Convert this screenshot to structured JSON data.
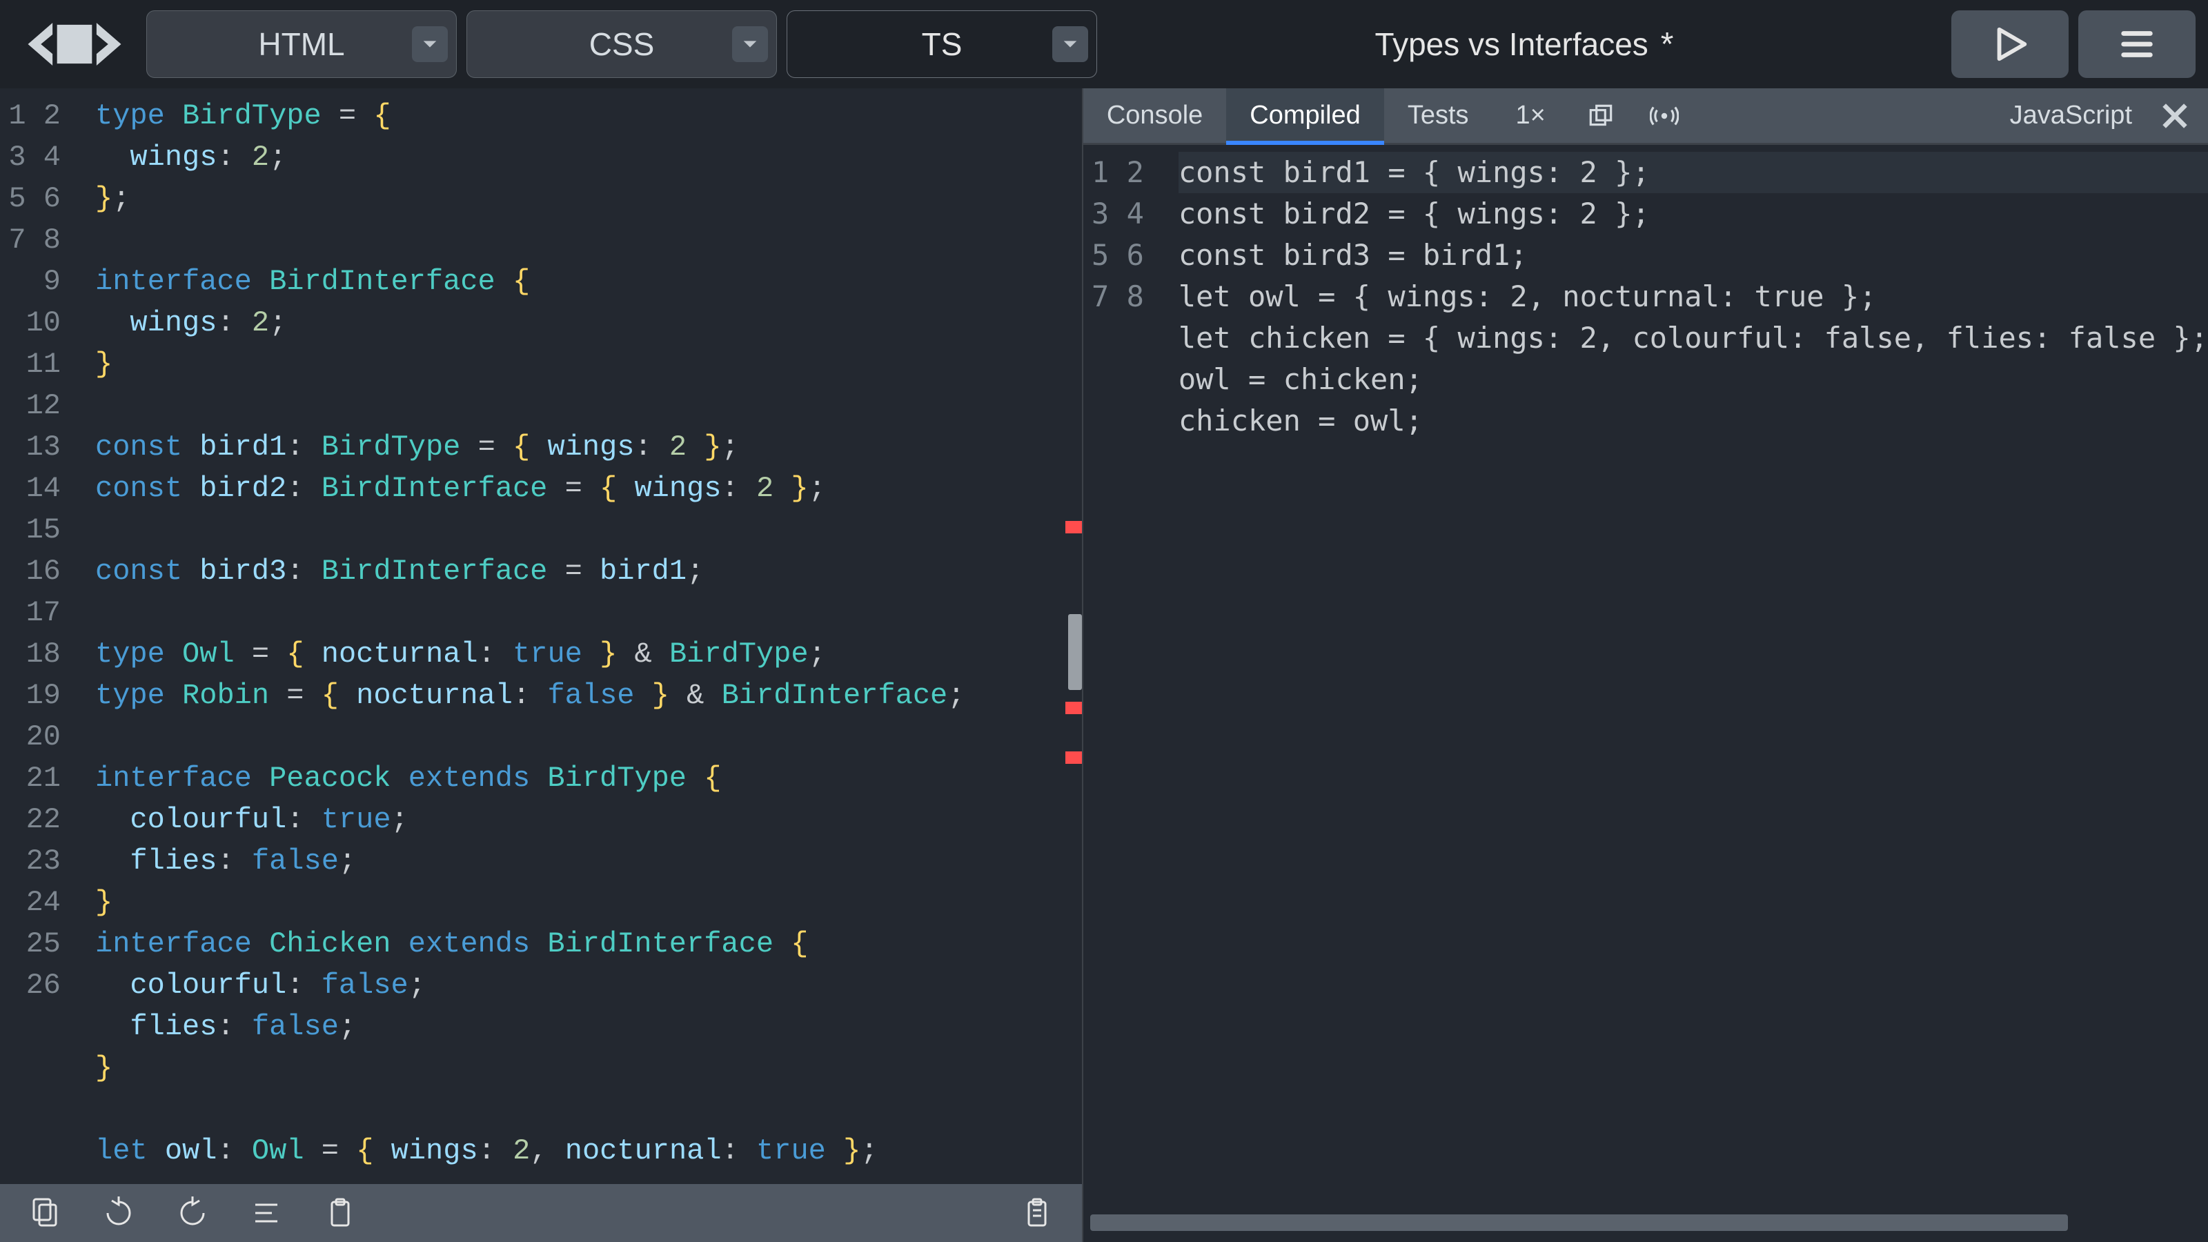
{
  "tabs": {
    "html": "HTML",
    "css": "CSS",
    "ts": "TS",
    "active": "TS"
  },
  "title": "Types vs Interfaces",
  "dirty_indicator": "*",
  "right_tabs": {
    "console": "Console",
    "compiled": "Compiled",
    "tests": "Tests",
    "zoom": "1×",
    "language": "JavaScript",
    "active": "Compiled"
  },
  "left_editor": {
    "line_numbers": [
      "1",
      "2",
      "3",
      "4",
      "5",
      "6",
      "7",
      "8",
      "9",
      "10",
      "11",
      "12",
      "13",
      "14",
      "15",
      "16",
      "17",
      "18",
      "19",
      "20",
      "21",
      "22",
      "23",
      "24",
      "25",
      "26"
    ],
    "lines": [
      [
        [
          "kw",
          "type"
        ],
        [
          "",
          ""
        ],
        [
          "type",
          "BirdType"
        ],
        [
          "",
          ""
        ],
        [
          "op",
          "="
        ],
        [
          "",
          ""
        ],
        [
          "br",
          "{"
        ]
      ],
      [
        [
          "",
          "  "
        ],
        [
          "prop",
          "wings"
        ],
        [
          "punc",
          ":"
        ],
        [
          "",
          ""
        ],
        [
          "num",
          "2"
        ],
        [
          "punc",
          ";"
        ]
      ],
      [
        [
          "br",
          "}"
        ],
        [
          "punc",
          ";"
        ]
      ],
      [
        [
          "",
          ""
        ]
      ],
      [
        [
          "kw",
          "interface"
        ],
        [
          "",
          ""
        ],
        [
          "type",
          "BirdInterface"
        ],
        [
          "",
          ""
        ],
        [
          "br",
          "{"
        ]
      ],
      [
        [
          "",
          "  "
        ],
        [
          "prop",
          "wings"
        ],
        [
          "punc",
          ":"
        ],
        [
          "",
          ""
        ],
        [
          "num",
          "2"
        ],
        [
          "punc",
          ";"
        ]
      ],
      [
        [
          "br",
          "}"
        ]
      ],
      [
        [
          "",
          ""
        ]
      ],
      [
        [
          "kw",
          "const"
        ],
        [
          "",
          ""
        ],
        [
          "id",
          "bird1"
        ],
        [
          "punc",
          ":"
        ],
        [
          "",
          ""
        ],
        [
          "type",
          "BirdType"
        ],
        [
          "",
          ""
        ],
        [
          "op",
          "="
        ],
        [
          "",
          ""
        ],
        [
          "br",
          "{"
        ],
        [
          "",
          ""
        ],
        [
          "prop",
          "wings"
        ],
        [
          "punc",
          ":"
        ],
        [
          "",
          ""
        ],
        [
          "num",
          "2"
        ],
        [
          "",
          ""
        ],
        [
          "br",
          "}"
        ],
        [
          "punc",
          ";"
        ]
      ],
      [
        [
          "kw",
          "const"
        ],
        [
          "",
          ""
        ],
        [
          "id",
          "bird2"
        ],
        [
          "punc",
          ":"
        ],
        [
          "",
          ""
        ],
        [
          "type",
          "BirdInterface"
        ],
        [
          "",
          ""
        ],
        [
          "op",
          "="
        ],
        [
          "",
          ""
        ],
        [
          "br",
          "{"
        ],
        [
          "",
          ""
        ],
        [
          "prop",
          "wings"
        ],
        [
          "punc",
          ":"
        ],
        [
          "",
          ""
        ],
        [
          "num",
          "2"
        ],
        [
          "",
          ""
        ],
        [
          "br",
          "}"
        ],
        [
          "punc",
          ";"
        ]
      ],
      [
        [
          "",
          ""
        ]
      ],
      [
        [
          "kw",
          "const"
        ],
        [
          "",
          ""
        ],
        [
          "id",
          "bird3"
        ],
        [
          "punc",
          ":"
        ],
        [
          "",
          ""
        ],
        [
          "type",
          "BirdInterface"
        ],
        [
          "",
          ""
        ],
        [
          "op",
          "="
        ],
        [
          "",
          ""
        ],
        [
          "id",
          "bird1"
        ],
        [
          "punc",
          ";"
        ]
      ],
      [
        [
          "",
          ""
        ]
      ],
      [
        [
          "kw",
          "type"
        ],
        [
          "",
          ""
        ],
        [
          "type",
          "Owl"
        ],
        [
          "",
          ""
        ],
        [
          "op",
          "="
        ],
        [
          "",
          ""
        ],
        [
          "br",
          "{"
        ],
        [
          "",
          ""
        ],
        [
          "prop",
          "nocturnal"
        ],
        [
          "punc",
          ":"
        ],
        [
          "",
          ""
        ],
        [
          "bool",
          "true"
        ],
        [
          "",
          ""
        ],
        [
          "br",
          "}"
        ],
        [
          "",
          ""
        ],
        [
          "op",
          "&"
        ],
        [
          "",
          ""
        ],
        [
          "type",
          "BirdType"
        ],
        [
          "punc",
          ";"
        ]
      ],
      [
        [
          "kw",
          "type"
        ],
        [
          "",
          ""
        ],
        [
          "type",
          "Robin"
        ],
        [
          "",
          ""
        ],
        [
          "op",
          "="
        ],
        [
          "",
          ""
        ],
        [
          "br",
          "{"
        ],
        [
          "",
          ""
        ],
        [
          "prop",
          "nocturnal"
        ],
        [
          "punc",
          ":"
        ],
        [
          "",
          ""
        ],
        [
          "bool",
          "false"
        ],
        [
          "",
          ""
        ],
        [
          "br",
          "}"
        ],
        [
          "",
          ""
        ],
        [
          "op",
          "&"
        ],
        [
          "",
          ""
        ],
        [
          "type",
          "BirdInterface"
        ],
        [
          "punc",
          ";"
        ]
      ],
      [
        [
          "",
          ""
        ]
      ],
      [
        [
          "kw",
          "interface"
        ],
        [
          "",
          ""
        ],
        [
          "type",
          "Peacock"
        ],
        [
          "",
          ""
        ],
        [
          "kw",
          "extends"
        ],
        [
          "",
          ""
        ],
        [
          "type",
          "BirdType"
        ],
        [
          "",
          ""
        ],
        [
          "br",
          "{"
        ]
      ],
      [
        [
          "",
          "  "
        ],
        [
          "prop",
          "colourful"
        ],
        [
          "punc",
          ":"
        ],
        [
          "",
          ""
        ],
        [
          "bool",
          "true"
        ],
        [
          "punc",
          ";"
        ]
      ],
      [
        [
          "",
          "  "
        ],
        [
          "prop",
          "flies"
        ],
        [
          "punc",
          ":"
        ],
        [
          "",
          ""
        ],
        [
          "bool",
          "false"
        ],
        [
          "punc",
          ";"
        ]
      ],
      [
        [
          "br",
          "}"
        ]
      ],
      [
        [
          "kw",
          "interface"
        ],
        [
          "",
          ""
        ],
        [
          "type",
          "Chicken"
        ],
        [
          "",
          ""
        ],
        [
          "kw",
          "extends"
        ],
        [
          "",
          ""
        ],
        [
          "type",
          "BirdInterface"
        ],
        [
          "",
          ""
        ],
        [
          "br",
          "{"
        ]
      ],
      [
        [
          "",
          "  "
        ],
        [
          "prop",
          "colourful"
        ],
        [
          "punc",
          ":"
        ],
        [
          "",
          ""
        ],
        [
          "bool",
          "false"
        ],
        [
          "punc",
          ";"
        ]
      ],
      [
        [
          "",
          "  "
        ],
        [
          "prop",
          "flies"
        ],
        [
          "punc",
          ":"
        ],
        [
          "",
          ""
        ],
        [
          "bool",
          "false"
        ],
        [
          "punc",
          ";"
        ]
      ],
      [
        [
          "br",
          "}"
        ]
      ],
      [
        [
          "",
          ""
        ]
      ],
      [
        [
          "kw",
          "let"
        ],
        [
          "",
          ""
        ],
        [
          "id",
          "owl"
        ],
        [
          "punc",
          ":"
        ],
        [
          "",
          ""
        ],
        [
          "type",
          "Owl"
        ],
        [
          "",
          ""
        ],
        [
          "op",
          "="
        ],
        [
          "",
          ""
        ],
        [
          "br",
          "{"
        ],
        [
          "",
          ""
        ],
        [
          "prop",
          "wings"
        ],
        [
          "punc",
          ":"
        ],
        [
          "",
          ""
        ],
        [
          "num",
          "2"
        ],
        [
          "punc",
          ","
        ],
        [
          "",
          ""
        ],
        [
          "prop",
          "nocturnal"
        ],
        [
          "punc",
          ":"
        ],
        [
          "",
          ""
        ],
        [
          "bool",
          "true"
        ],
        [
          "",
          ""
        ],
        [
          "br",
          "}"
        ],
        [
          "punc",
          ";"
        ]
      ]
    ],
    "error_markers_pct": [
      39.5,
      56.0,
      60.5
    ],
    "scroll_thumb_top_pct": 48
  },
  "right_editor": {
    "line_numbers": [
      "1",
      "2",
      "3",
      "4",
      "5",
      "6",
      "7",
      "8"
    ],
    "lines": [
      [
        [
          "kw",
          "const"
        ],
        [
          "",
          ""
        ],
        [
          "id",
          "bird1"
        ],
        [
          "",
          ""
        ],
        [
          "op",
          "="
        ],
        [
          "",
          ""
        ],
        [
          "br",
          "{"
        ],
        [
          "",
          ""
        ],
        [
          "prop",
          "wings"
        ],
        [
          "punc",
          ":"
        ],
        [
          "",
          ""
        ],
        [
          "num",
          "2"
        ],
        [
          "",
          ""
        ],
        [
          "br",
          "}"
        ],
        [
          "punc",
          ";"
        ]
      ],
      [
        [
          "kw",
          "const"
        ],
        [
          "",
          ""
        ],
        [
          "id",
          "bird2"
        ],
        [
          "",
          ""
        ],
        [
          "op",
          "="
        ],
        [
          "",
          ""
        ],
        [
          "br",
          "{"
        ],
        [
          "",
          ""
        ],
        [
          "prop",
          "wings"
        ],
        [
          "punc",
          ":"
        ],
        [
          "",
          ""
        ],
        [
          "num",
          "2"
        ],
        [
          "",
          ""
        ],
        [
          "br",
          "}"
        ],
        [
          "punc",
          ";"
        ]
      ],
      [
        [
          "kw",
          "const"
        ],
        [
          "",
          ""
        ],
        [
          "id",
          "bird3"
        ],
        [
          "",
          ""
        ],
        [
          "op",
          "="
        ],
        [
          "",
          ""
        ],
        [
          "id",
          "bird1"
        ],
        [
          "punc",
          ";"
        ]
      ],
      [
        [
          "kw",
          "let"
        ],
        [
          "",
          ""
        ],
        [
          "id",
          "owl"
        ],
        [
          "",
          ""
        ],
        [
          "op",
          "="
        ],
        [
          "",
          ""
        ],
        [
          "br",
          "{"
        ],
        [
          "",
          ""
        ],
        [
          "prop",
          "wings"
        ],
        [
          "punc",
          ":"
        ],
        [
          "",
          ""
        ],
        [
          "num",
          "2"
        ],
        [
          "punc",
          ","
        ],
        [
          "",
          ""
        ],
        [
          "prop",
          "nocturnal"
        ],
        [
          "punc",
          ":"
        ],
        [
          "",
          ""
        ],
        [
          "bool",
          "true"
        ],
        [
          "",
          ""
        ],
        [
          "br",
          "}"
        ],
        [
          "punc",
          ";"
        ]
      ],
      [
        [
          "kw",
          "let"
        ],
        [
          "",
          ""
        ],
        [
          "id",
          "chicken"
        ],
        [
          "",
          ""
        ],
        [
          "op",
          "="
        ],
        [
          "",
          ""
        ],
        [
          "br",
          "{"
        ],
        [
          "",
          ""
        ],
        [
          "prop",
          "wings"
        ],
        [
          "punc",
          ":"
        ],
        [
          "",
          ""
        ],
        [
          "num",
          "2"
        ],
        [
          "punc",
          ","
        ],
        [
          "",
          ""
        ],
        [
          "prop",
          "colourful"
        ],
        [
          "punc",
          ":"
        ],
        [
          "",
          ""
        ],
        [
          "bool",
          "false"
        ],
        [
          "punc",
          ","
        ],
        [
          "",
          ""
        ],
        [
          "prop",
          "flies"
        ],
        [
          "punc",
          ":"
        ],
        [
          "",
          ""
        ],
        [
          "bool",
          "false"
        ],
        [
          "",
          ""
        ],
        [
          "br",
          "}"
        ],
        [
          "punc",
          ";"
        ]
      ],
      [
        [
          "id",
          "owl"
        ],
        [
          "",
          ""
        ],
        [
          "op",
          "="
        ],
        [
          "",
          ""
        ],
        [
          "id",
          "chicken"
        ],
        [
          "punc",
          ";"
        ]
      ],
      [
        [
          "id",
          "chicken"
        ],
        [
          "",
          ""
        ],
        [
          "op",
          "="
        ],
        [
          "",
          ""
        ],
        [
          "id",
          "owl"
        ],
        [
          "punc",
          ";"
        ]
      ],
      [
        [
          "",
          ""
        ]
      ]
    ],
    "highlight_line_index": 0
  },
  "icons": {
    "logo": "playcode-logo-icon",
    "run": "run-icon",
    "menu": "menu-icon",
    "copy": "copy-icon",
    "refresh": "refresh-icon",
    "undo": "undo-icon",
    "format": "format-icon",
    "paste": "paste-icon",
    "clipboard_right": "clipboard-icon",
    "pop_out": "popout-icon",
    "live": "broadcast-icon",
    "close": "close-icon",
    "dropdown": "chevron-down-icon"
  }
}
